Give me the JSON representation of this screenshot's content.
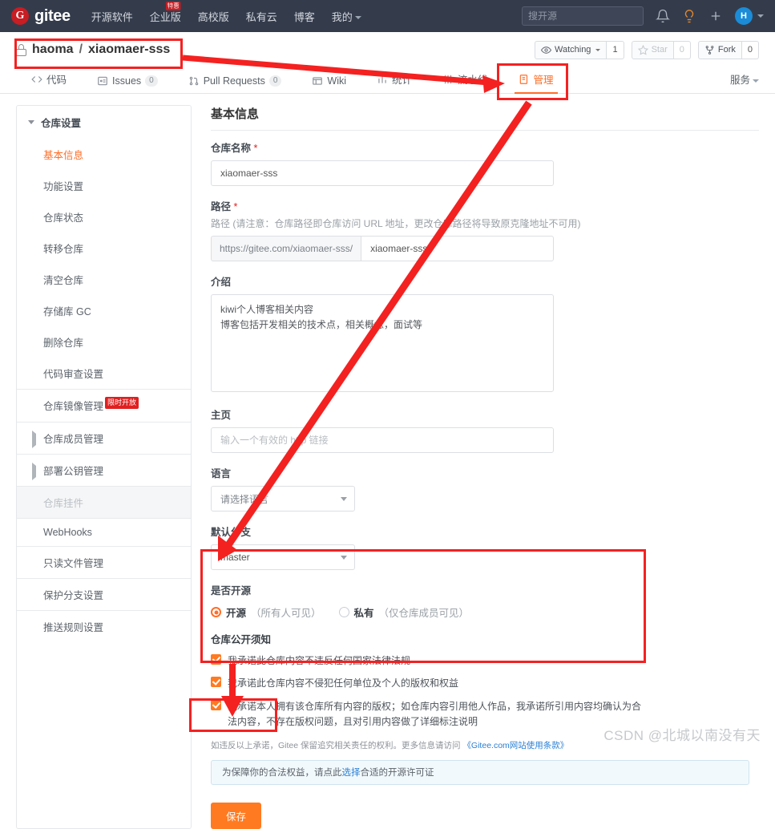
{
  "header": {
    "brand": "gitee",
    "brand_mark": "G",
    "nav": [
      {
        "label": "开源软件",
        "badge": ""
      },
      {
        "label": "企业版",
        "badge": "特惠"
      },
      {
        "label": "高校版",
        "badge": ""
      },
      {
        "label": "私有云",
        "badge": ""
      },
      {
        "label": "博客",
        "badge": ""
      },
      {
        "label": "我的",
        "badge": "",
        "caret": true
      }
    ],
    "search_placeholder": "搜开源",
    "icons": [
      "bell-icon",
      "lightbulb-icon",
      "plus-icon"
    ],
    "avatar_initial": "H"
  },
  "repo": {
    "owner": "haoma",
    "separator": "/",
    "name": "xiaomaer-sss",
    "lock": "lock-icon",
    "watching_label": "Watching",
    "watching_count": "1",
    "star_label": "Star",
    "star_count": "0",
    "fork_label": "Fork",
    "fork_count": "0"
  },
  "tabs": [
    {
      "label": "代码",
      "icon": "code-icon",
      "count": "",
      "active": false
    },
    {
      "label": "Issues",
      "icon": "issue-icon",
      "count": "0",
      "active": false
    },
    {
      "label": "Pull Requests",
      "icon": "pr-icon",
      "count": "0",
      "active": false
    },
    {
      "label": "Wiki",
      "icon": "wiki-icon",
      "count": "",
      "active": false
    },
    {
      "label": "统计",
      "icon": "chart-icon",
      "count": "",
      "active": false
    },
    {
      "label": "流水线",
      "icon": "pipeline-icon",
      "count": "",
      "active": false
    },
    {
      "label": "管理",
      "icon": "manage-icon",
      "count": "",
      "active": true
    }
  ],
  "tabs_right": "服务",
  "sidebar": {
    "group_title": "仓库设置",
    "items": [
      {
        "label": "基本信息",
        "active": true,
        "muted": false,
        "expandable": false,
        "badge": ""
      },
      {
        "label": "功能设置",
        "active": false,
        "muted": false,
        "expandable": false,
        "badge": ""
      },
      {
        "label": "仓库状态",
        "active": false,
        "muted": false,
        "expandable": false,
        "badge": ""
      },
      {
        "label": "转移仓库",
        "active": false,
        "muted": false,
        "expandable": false,
        "badge": ""
      },
      {
        "label": "清空仓库",
        "active": false,
        "muted": false,
        "expandable": false,
        "badge": ""
      },
      {
        "label": "存储库 GC",
        "active": false,
        "muted": false,
        "expandable": false,
        "badge": ""
      },
      {
        "label": "删除仓库",
        "active": false,
        "muted": false,
        "expandable": false,
        "badge": ""
      },
      {
        "label": "代码审查设置",
        "active": false,
        "muted": false,
        "expandable": false,
        "badge": ""
      },
      {
        "label": "仓库镜像管理",
        "active": false,
        "muted": false,
        "expandable": false,
        "badge": "限时开放",
        "bordered": true
      },
      {
        "label": "仓库成员管理",
        "active": false,
        "muted": false,
        "expandable": true,
        "badge": "",
        "bordered": true
      },
      {
        "label": "部署公钥管理",
        "active": false,
        "muted": false,
        "expandable": true,
        "badge": "",
        "bordered": true
      },
      {
        "label": "仓库挂件",
        "active": false,
        "muted": true,
        "expandable": false,
        "badge": "",
        "bordered": true
      },
      {
        "label": "WebHooks",
        "active": false,
        "muted": false,
        "expandable": false,
        "badge": "",
        "bordered": true
      },
      {
        "label": "只读文件管理",
        "active": false,
        "muted": false,
        "expandable": false,
        "badge": "",
        "bordered": true
      },
      {
        "label": "保护分支设置",
        "active": false,
        "muted": false,
        "expandable": false,
        "badge": "",
        "bordered": true
      },
      {
        "label": "推送规则设置",
        "active": false,
        "muted": false,
        "expandable": false,
        "badge": "",
        "bordered": true
      }
    ]
  },
  "main": {
    "title": "基本信息",
    "repo_name": {
      "label": "仓库名称",
      "required": "*",
      "value": "xiaomaer-sss"
    },
    "path": {
      "label": "路径",
      "required": "*",
      "hint": "路径 (请注意：仓库路径即仓库访问 URL 地址，更改仓库路径将导致原克隆地址不可用)",
      "prefix": "https://gitee.com/xiaomaer-sss/",
      "value": "xiaomaer-sss"
    },
    "intro": {
      "label": "介绍",
      "value": "kiwi个人博客相关内容\n博客包括开发相关的技术点，相关概念，面试等"
    },
    "homepage": {
      "label": "主页",
      "placeholder": "输入一个有效的 http 链接",
      "value": ""
    },
    "language": {
      "label": "语言",
      "value": "请选择语言"
    },
    "default_branch": {
      "label": "默认分支",
      "value": "master"
    },
    "open_source": {
      "label": "是否开源",
      "options": [
        {
          "name": "开源",
          "note": "（所有人可见）",
          "selected": true
        },
        {
          "name": "私有",
          "note": "（仅仓库成员可见）",
          "selected": false
        }
      ]
    },
    "public_notice": {
      "title": "仓库公开须知",
      "checks": [
        {
          "text": "我承诺此仓库内容不违反任何国家法律法规",
          "checked": true
        },
        {
          "text": "我承诺此仓库内容不侵犯任何单位及个人的版权和权益",
          "checked": true
        },
        {
          "text": "我承诺本人拥有该仓库所有内容的版权；如仓库内容引用他人作品，我承诺所引用内容均确认为合法内容，不存在版权问题，且对引用内容做了详细标注说明",
          "checked": true
        }
      ],
      "fineprint_before": "如违反以上承诺，Gitee 保留追究相关责任的权利。更多信息请访问 ",
      "fineprint_link": "《Gitee.com网站使用条款》"
    },
    "license_bar": {
      "before": "为保障你的合法权益，请点此 ",
      "link": "选择",
      "after": " 合适的开源许可证"
    },
    "save_label": "保存"
  },
  "watermark": "CSDN @北城以南没有天",
  "annotation_color": "#f42121"
}
